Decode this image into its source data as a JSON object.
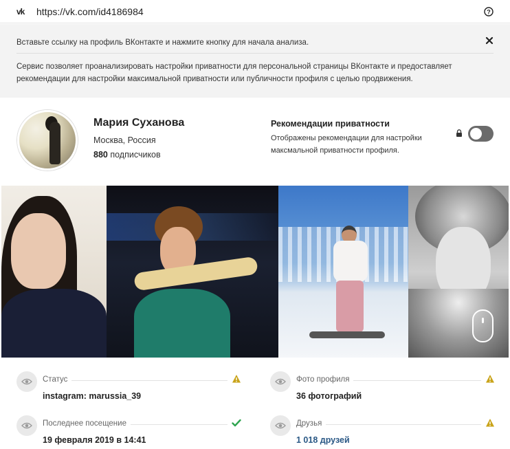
{
  "urlbar": {
    "site_icon": "vk-logo-icon",
    "site_logo_text": "vk",
    "url": "https://vk.com/id4186984",
    "help_icon": "help-circle-icon"
  },
  "info": {
    "instruction": "Вставьте ссылку на профиль ВКонтакте и нажмите кнопку для начала анализа.",
    "description": "Сервис позволяет проанализировать настройки приватности для персональной страницы ВКонтакте и предоставляет рекомендации для настройки максимальной приватности или публичности профиля с целью продвижения.",
    "close_icon": "close-icon"
  },
  "profile": {
    "name": "Мария Суханова",
    "city": "Москва, Россия",
    "subscribers_count": "880",
    "subscribers_label": "подписчиков"
  },
  "recommendations": {
    "title": "Рекомендации приватности",
    "text": "Отображены рекомендации для настройки максмальной приватности профиля.",
    "lock_icon": "lock-icon",
    "toggle_on": false
  },
  "photos": [
    {
      "name": "photo-1"
    },
    {
      "name": "photo-2"
    },
    {
      "name": "photo-3"
    },
    {
      "name": "photo-4"
    }
  ],
  "stats": [
    {
      "label": "Статус",
      "value": "instagram: marussia_39",
      "indicator": "warning-icon",
      "link": false
    },
    {
      "label": "Фото профиля",
      "value": "36 фотографий",
      "indicator": "warning-icon",
      "link": false
    },
    {
      "label": "Последнее посещение",
      "value": "19 февраля 2019 в 14:41",
      "indicator": "check-icon",
      "link": false
    },
    {
      "label": "Друзья",
      "value": "1 018 друзей",
      "indicator": "warning-icon",
      "link": true
    }
  ],
  "colors": {
    "warning": "#c9a319",
    "check": "#2ea44f",
    "link": "#2a5885",
    "toggle_off": "#6b6b6b"
  }
}
